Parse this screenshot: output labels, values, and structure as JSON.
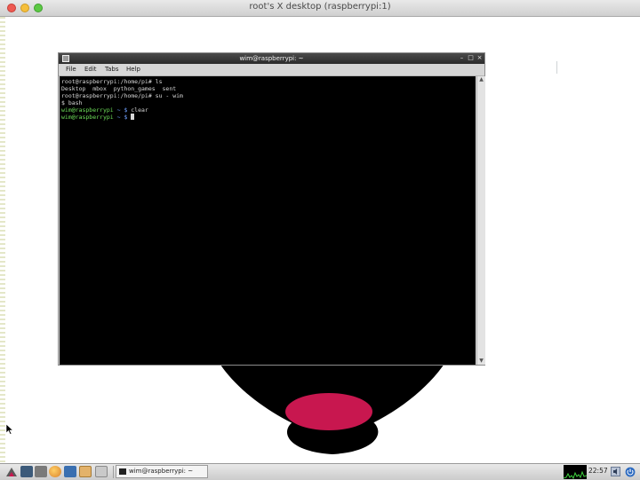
{
  "window": {
    "title": "root's X desktop (raspberrypi:1)"
  },
  "terminal": {
    "title": "wim@raspberrypi: ~",
    "title_buttons": [
      "–",
      "□",
      "×"
    ],
    "menu": [
      "File",
      "Edit",
      "Tabs",
      "Help"
    ],
    "lines": [
      {
        "prompt": "root@raspberrypi:/home/pi#",
        "command": " ls",
        "style": "root"
      },
      {
        "text": "Desktop  mbox  python_games  sent",
        "style": "output"
      },
      {
        "prompt": "root@raspberrypi:/home/pi#",
        "command": " su - wim",
        "style": "root"
      },
      {
        "text": "$ bash",
        "style": "output"
      },
      {
        "prompt": "wim@raspberrypi",
        "path": " ~ $",
        "command": " clear",
        "style": "user"
      },
      {
        "prompt": "wim@raspberrypi",
        "path": " ~ $",
        "command": " ",
        "style": "user",
        "cursor": true
      }
    ]
  },
  "taskbar": {
    "task_label": "wim@raspberrypi: ~",
    "clock": "22:57"
  },
  "colors": {
    "terminal_background": "#000000",
    "prompt_green": "#6ee05a",
    "prompt_path_blue": "#6fa0ff",
    "raspberry_red": "#c8174f"
  },
  "icons": [
    "menu-start-icon",
    "desktop-icon",
    "file-manager-icon",
    "browser-icon",
    "folder-icon",
    "terminal-icon",
    "volume-icon",
    "shutdown-icon"
  ]
}
